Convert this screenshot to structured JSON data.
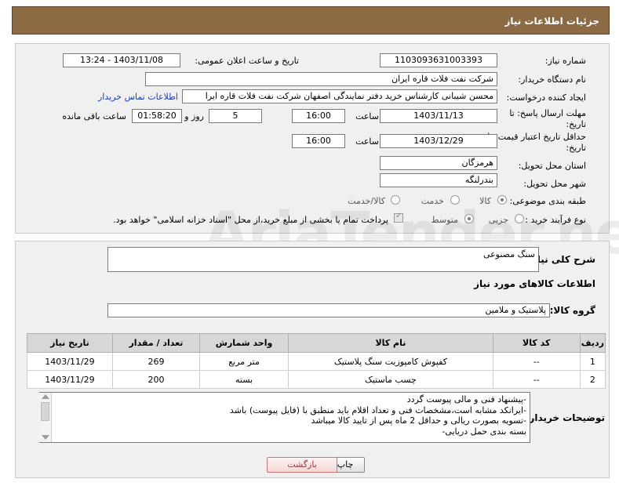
{
  "page": {
    "title": "جزئیات اطلاعات نیاز"
  },
  "details": {
    "need_number_label": "شماره نیاز:",
    "need_number": "1103093631003393",
    "announce_label": "تاریخ و ساعت اعلان عمومی:",
    "announce_value": "1403/11/08 - 13:24",
    "buyer_org_label": "نام دستگاه خریدار:",
    "buyer_org": "شرکت نفت فلات قاره ایران",
    "requester_label": "ایجاد کننده درخواست:",
    "requester": "محسن شیبانی کارشناس خرید دفتر نمایندگی اصفهان شرکت نفت فلات قاره ایرا",
    "contact_link": "اطلاعات تماس خریدار",
    "deadline_label_1": "مهلت ارسال پاسخ: تا",
    "deadline_label_2": "تاریخ:",
    "deadline_date": "1403/11/13",
    "time_label": "ساعت",
    "deadline_time": "16:00",
    "days_value": "5",
    "days_label": "روز و",
    "remaining_value": "01:58:20",
    "remaining_label": "ساعت باقی مانده",
    "validity_label_1": "حداقل تاریخ اعتبار قیمت: تا",
    "validity_label_2": "تاریخ:",
    "validity_date": "1403/12/29",
    "validity_time": "16:00",
    "province_label": "استان محل تحویل:",
    "province": "هرمزگان",
    "city_label": "شهر محل تحویل:",
    "city": "بندرلنگه",
    "category_label": "طبقه بندی موضوعی:",
    "category_options": [
      "کالا",
      "خدمت",
      "کالا/خدمت"
    ],
    "process_label": "نوع فرآیند خرید :",
    "process_options": [
      "جزیی",
      "متوسط"
    ],
    "payment_note": "پرداخت تمام یا بخشی از مبلغ خرید،از محل \"اسناد خزانه اسلامی\" خواهد بود."
  },
  "summary": {
    "desc_label": "شرح کلی نیاز:",
    "desc_value": "سنگ مصنوعی",
    "items_title": "اطلاعات کالاهای مورد نیاز",
    "group_label": "گروه کالا:",
    "group_value": "پلاستیک و ملامین"
  },
  "table": {
    "headers": [
      "ردیف",
      "کد کالا",
      "نام کالا",
      "واحد شمارش",
      "تعداد / مقدار",
      "تاریخ نیاز"
    ],
    "rows": [
      [
        "1",
        "--",
        "کفپوش کامپوزیت سنگ پلاستیک",
        "متر مربع",
        "269",
        "1403/11/29"
      ],
      [
        "2",
        "--",
        "چسب ماستیک",
        "بسته",
        "200",
        "1403/11/29"
      ]
    ]
  },
  "notes": {
    "label": "توضیحات خریدار:",
    "lines": [
      "-پیشنهاد فنی و مالی پیوست گردد",
      "-ایرانکد مشابه است،مشخصات فنی و تعداد اقلام باید منطبق با (فایل پیوست) باشد",
      "-تسویه بصورت ریالی و حداقل 2 ماه پس از تایید کالا میباشد",
      "بسته بندی حمل دریایی-"
    ]
  },
  "buttons": {
    "print": "چاپ",
    "back": "بازگشت"
  },
  "watermark": "AriaTender.neT"
}
